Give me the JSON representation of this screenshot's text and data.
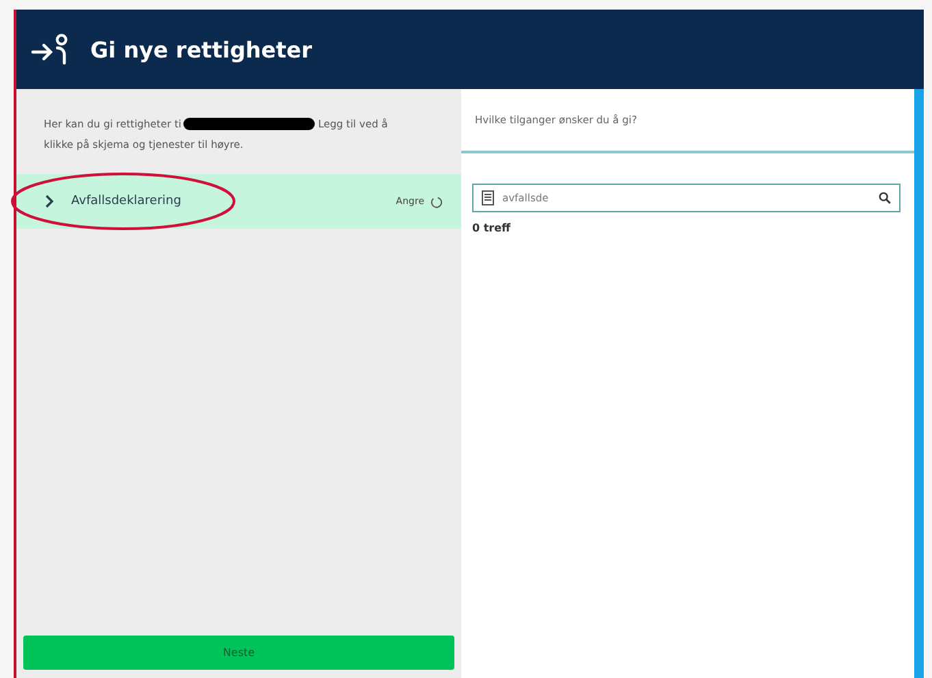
{
  "header": {
    "title": "Gi nye rettigheter"
  },
  "left_panel": {
    "intro": {
      "before": "Her kan du gi rettigheter ti",
      "after": "Legg til ved å",
      "continuation": "klikke på skjema og tjenester til høyre."
    },
    "items": [
      {
        "label": "Avfallsdeklarering",
        "action": "Angre",
        "expanded": false,
        "circled": true
      }
    ],
    "next_button": "Neste"
  },
  "right_panel": {
    "question": "Hvilke tilganger ønsker du å gi?",
    "search": {
      "value": "avfallsde"
    },
    "result_count": "0 treff"
  }
}
